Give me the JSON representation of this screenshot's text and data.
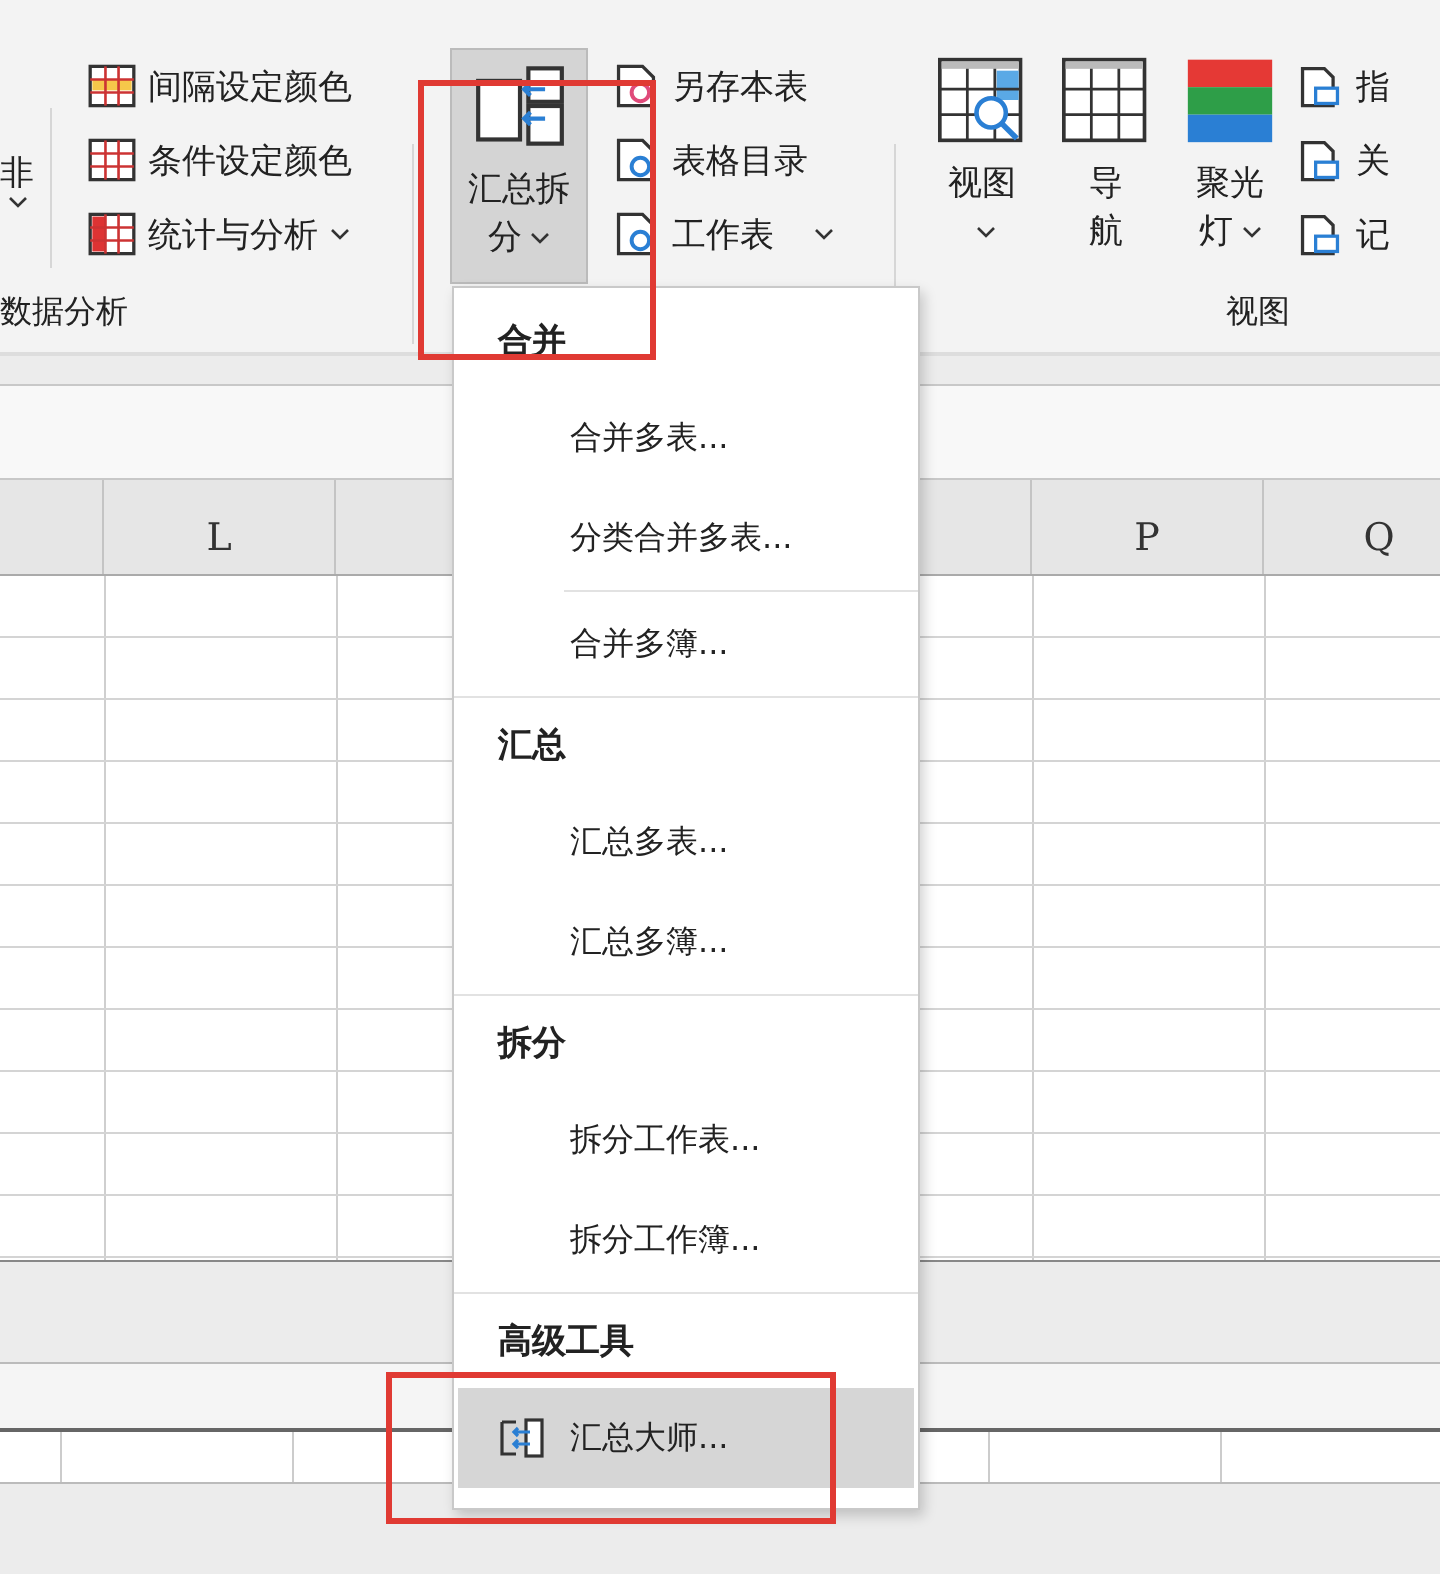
{
  "ribbon": {
    "partial_button": {
      "label": "非",
      "dropdown": true
    },
    "analysis_group": {
      "label": "数据分析",
      "items": [
        {
          "label": "间隔设定颜色",
          "dropdown": false
        },
        {
          "label": "条件设定颜色",
          "dropdown": false
        },
        {
          "label": "统计与分析",
          "dropdown": true
        }
      ]
    },
    "split_group": {
      "big_button": {
        "label": "汇总拆分",
        "dropdown": true,
        "pressed": true
      },
      "items": [
        {
          "label": "另存本表",
          "dropdown": false
        },
        {
          "label": "表格目录",
          "dropdown": false
        },
        {
          "label": "工作表",
          "dropdown": true
        }
      ]
    },
    "view_group": {
      "label": "视图",
      "big_buttons": [
        {
          "label": "视图",
          "dropdown": true
        },
        {
          "label": "导航",
          "dropdown": false
        },
        {
          "label": "聚光灯",
          "dropdown": true
        }
      ],
      "items": [
        {
          "label": "指"
        },
        {
          "label": "关"
        },
        {
          "label": "记"
        }
      ]
    }
  },
  "sheet": {
    "columns": [
      {
        "label": "L"
      },
      {
        "label": "P"
      },
      {
        "label": "Q"
      }
    ]
  },
  "menu": {
    "sections": [
      {
        "title": "合并",
        "groups": [
          [
            {
              "label": "合并多表...",
              "kind": "plain",
              "selected": false
            },
            {
              "label": "分类合并多表...",
              "kind": "plain",
              "selected": false
            }
          ],
          [
            {
              "label": "合并多簿...",
              "kind": "plain",
              "selected": false
            }
          ]
        ]
      },
      {
        "title": "汇总",
        "groups": [
          [
            {
              "label": "汇总多表...",
              "kind": "plain",
              "selected": false
            },
            {
              "label": "汇总多簿...",
              "kind": "plain",
              "selected": false
            }
          ]
        ]
      },
      {
        "title": "拆分",
        "groups": [
          [
            {
              "label": "拆分工作表...",
              "kind": "plain",
              "selected": false
            },
            {
              "label": "拆分工作簿...",
              "kind": "plain",
              "selected": false
            }
          ]
        ]
      },
      {
        "title": "高级工具",
        "groups": [
          [
            {
              "label": "汇总大师...",
              "kind": "icon",
              "selected": true
            }
          ]
        ]
      }
    ]
  }
}
